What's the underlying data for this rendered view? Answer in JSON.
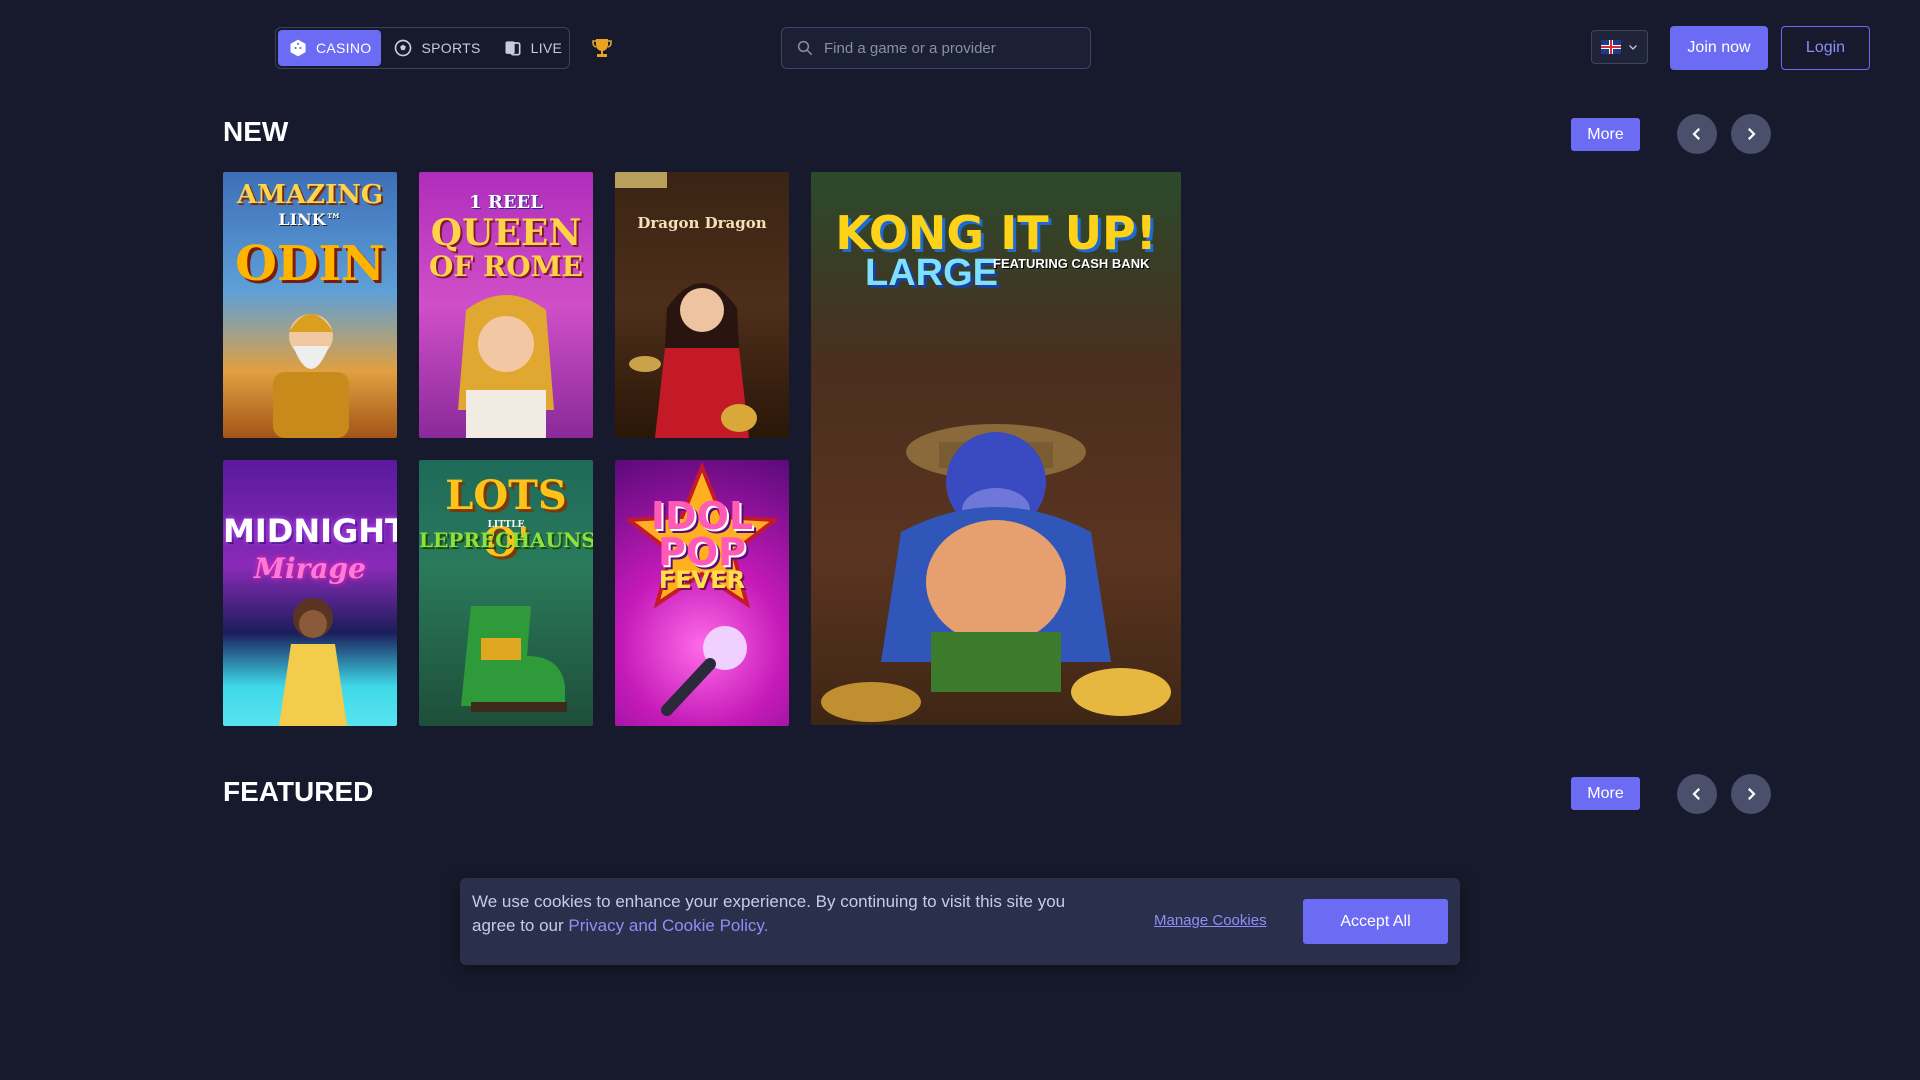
{
  "nav": {
    "tabs": [
      {
        "label": "CASINO",
        "icon": "dice-icon",
        "active": true
      },
      {
        "label": "SPORTS",
        "icon": "soccer-ball-icon",
        "active": false
      },
      {
        "label": "LIVE",
        "icon": "live-cards-icon",
        "active": false
      }
    ],
    "trophy_icon": "trophy-icon"
  },
  "search": {
    "placeholder": "Find a game or a provider"
  },
  "language": {
    "flag": "uk-flag-icon"
  },
  "auth": {
    "join_label": "Join now",
    "login_label": "Login"
  },
  "sections": {
    "new": {
      "title": "NEW",
      "more_label": "More"
    },
    "featured": {
      "title": "FEATURED",
      "more_label": "More"
    }
  },
  "games": [
    {
      "line1": "AMAZING",
      "line2": "LINK™",
      "line3": "ODIN"
    },
    {
      "line1": "1 REEL",
      "line2": "QUEEN",
      "line3": "OF ROME"
    },
    {
      "line1": "Dragon Dragon",
      "line2": "",
      "line3": ""
    },
    {
      "line1": "KONG IT UP!",
      "line2": "LARGE",
      "line3": "FEATURING CASH BANK"
    },
    {
      "line1": "MIDNIGHT",
      "line2": "Mirage",
      "line3": ""
    },
    {
      "line1": "LOTS O'",
      "line2": "LITTLE",
      "line3": "LEPRECHAUNS"
    },
    {
      "line1": "IDOL",
      "line2": "POP",
      "line3": "FEVER"
    }
  ],
  "cookie": {
    "text": "We use cookies to enhance your experience. By continuing to visit this site you agree to our ",
    "link": "Privacy and Cookie Policy",
    "period": ".",
    "manage_label": "Manage Cookies",
    "accept_label": "Accept All"
  },
  "colors": {
    "accent": "#6b6cf3",
    "background": "#161a2c"
  }
}
